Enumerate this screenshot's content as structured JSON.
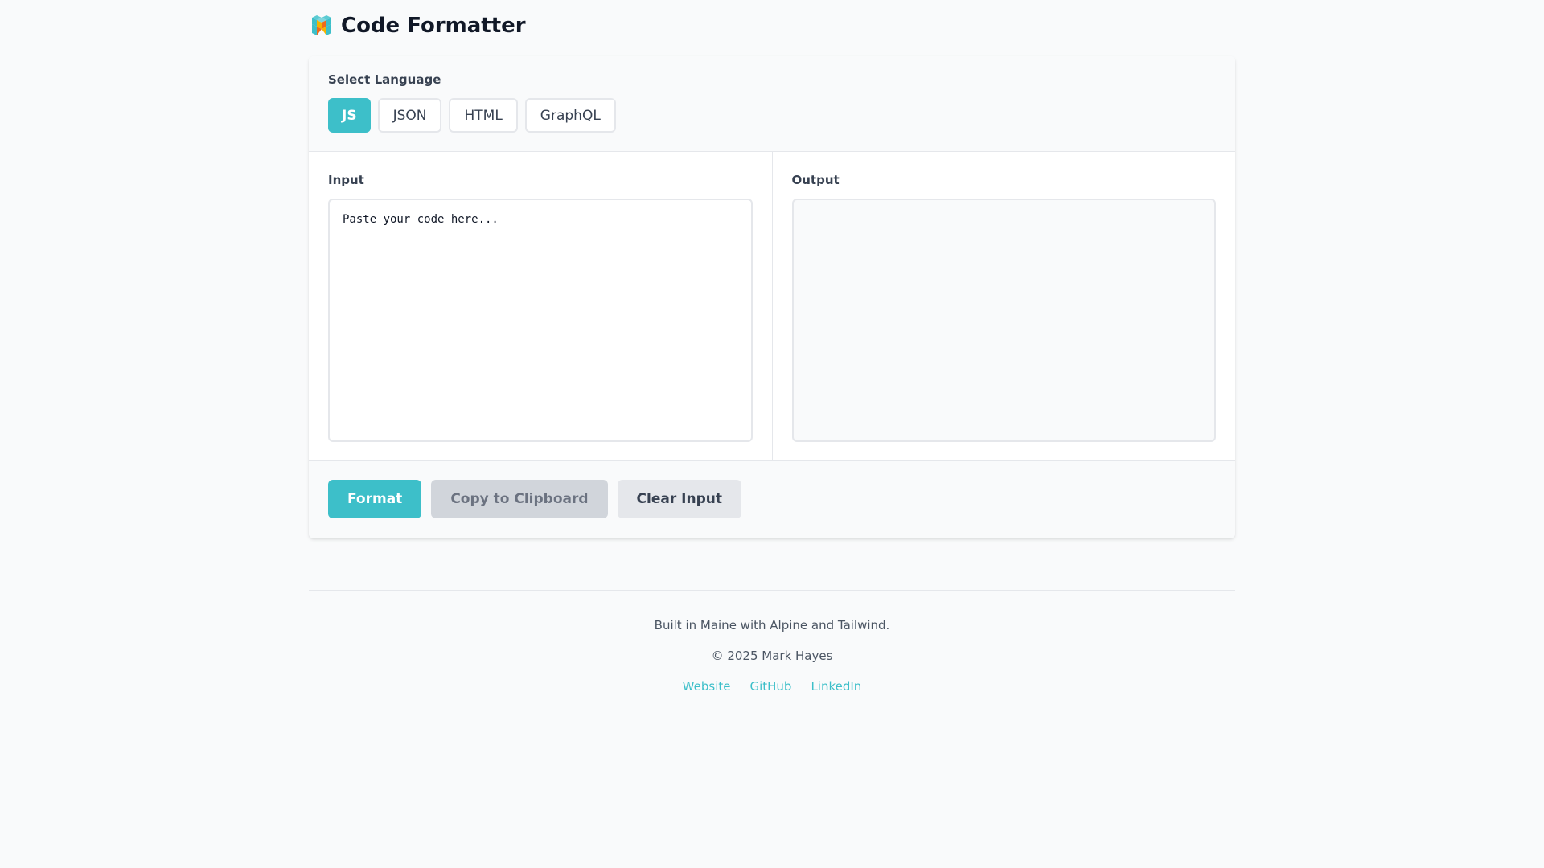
{
  "header": {
    "title": "Code Formatter"
  },
  "language": {
    "label": "Select Language",
    "options": [
      "JS",
      "JSON",
      "HTML",
      "GraphQL"
    ],
    "selected": "JS"
  },
  "input": {
    "label": "Input",
    "placeholder": "Paste your code here...",
    "value": ""
  },
  "output": {
    "label": "Output",
    "value": ""
  },
  "actions": {
    "format": "Format",
    "copy": "Copy to Clipboard",
    "clear": "Clear Input"
  },
  "footer": {
    "built": "Built in Maine with Alpine and Tailwind.",
    "copyright": "© 2025 Mark Hayes",
    "links": [
      "Website",
      "GitHub",
      "LinkedIn"
    ]
  },
  "colors": {
    "accent": "#3dbfc9"
  }
}
